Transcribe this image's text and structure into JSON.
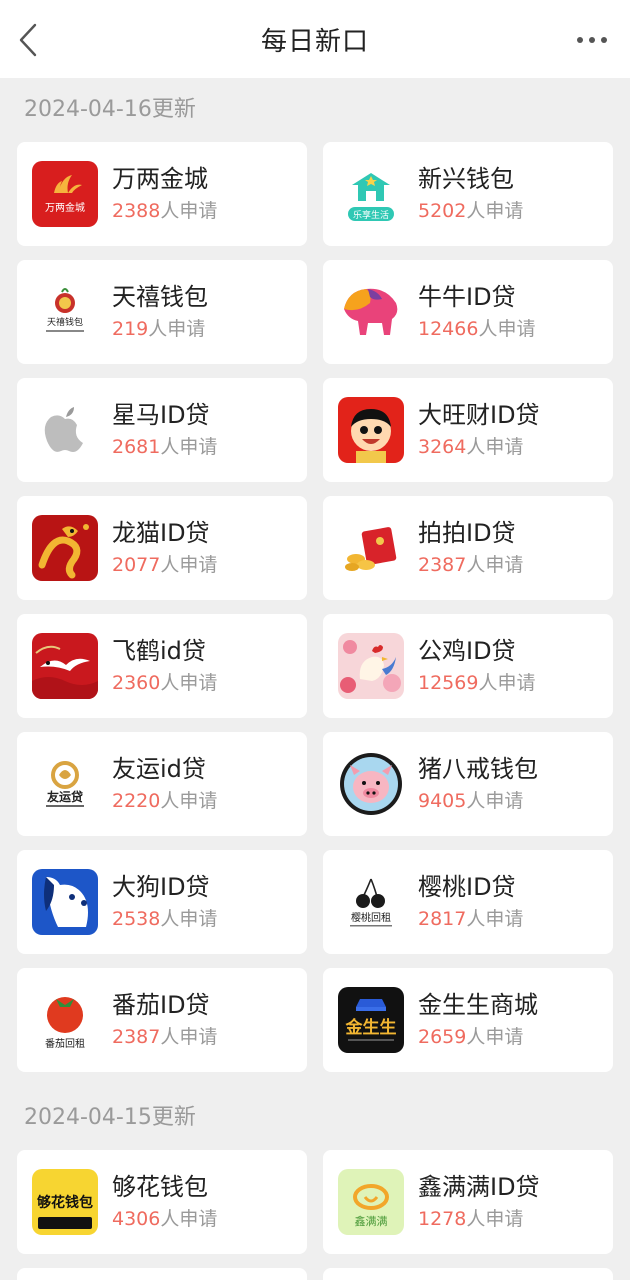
{
  "header": {
    "title": "每日新口",
    "back_icon": "chevron-left-icon",
    "more_icon": "more-dots-icon"
  },
  "sections": [
    {
      "date_label": "2024-04-16更新",
      "items": [
        {
          "name": "万两金城",
          "count": "2388",
          "suffix": "人申请",
          "logo_text": "万两金城"
        },
        {
          "name": "新兴钱包",
          "count": "5202",
          "suffix": "人申请",
          "logo_text": "乐享生活"
        },
        {
          "name": "天禧钱包",
          "count": "219",
          "suffix": "人申请",
          "logo_text": "天禧钱包"
        },
        {
          "name": "牛牛ID贷",
          "count": "12466",
          "suffix": "人申请",
          "logo_text": ""
        },
        {
          "name": "星马ID贷",
          "count": "2681",
          "suffix": "人申请",
          "logo_text": ""
        },
        {
          "name": "大旺财ID贷",
          "count": "3264",
          "suffix": "人申请",
          "logo_text": ""
        },
        {
          "name": "龙猫ID贷",
          "count": "2077",
          "suffix": "人申请",
          "logo_text": ""
        },
        {
          "name": "拍拍ID贷",
          "count": "2387",
          "suffix": "人申请",
          "logo_text": ""
        },
        {
          "name": "飞鹤id贷",
          "count": "2360",
          "suffix": "人申请",
          "logo_text": ""
        },
        {
          "name": "公鸡ID贷",
          "count": "12569",
          "suffix": "人申请",
          "logo_text": ""
        },
        {
          "name": "友运id贷",
          "count": "2220",
          "suffix": "人申请",
          "logo_text": "友运贷"
        },
        {
          "name": "猪八戒钱包",
          "count": "9405",
          "suffix": "人申请",
          "logo_text": ""
        },
        {
          "name": "大狗ID贷",
          "count": "2538",
          "suffix": "人申请",
          "logo_text": ""
        },
        {
          "name": "樱桃ID贷",
          "count": "2817",
          "suffix": "人申请",
          "logo_text": "樱桃回租"
        },
        {
          "name": "番茄ID贷",
          "count": "2387",
          "suffix": "人申请",
          "logo_text": "番茄回租"
        },
        {
          "name": "金生生商城",
          "count": "2659",
          "suffix": "人申请",
          "logo_text": "金生生"
        }
      ]
    },
    {
      "date_label": "2024-04-15更新",
      "items": [
        {
          "name": "够花钱包",
          "count": "4306",
          "suffix": "人申请",
          "logo_text": "够花钱包"
        },
        {
          "name": "鑫满满ID贷",
          "count": "1278",
          "suffix": "人申请",
          "logo_text": "鑫满满"
        }
      ]
    }
  ],
  "colors": {
    "accent": "#ef6b5f",
    "muted": "#9a9a9a",
    "background": "#efefef"
  }
}
